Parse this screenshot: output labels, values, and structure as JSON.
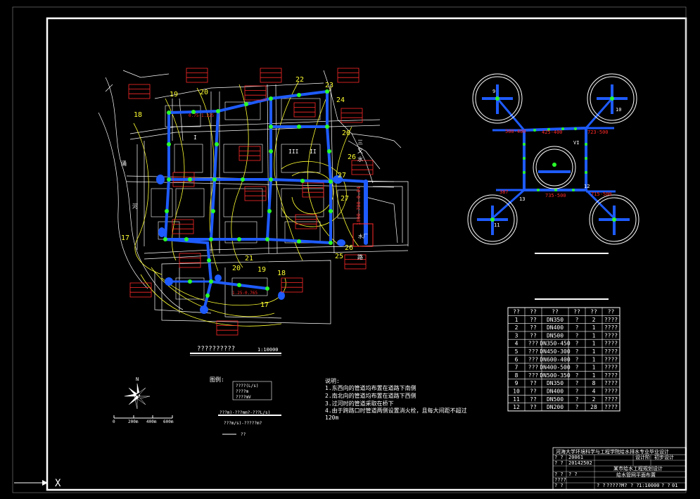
{
  "colors": {
    "pipe": "#1e5bff",
    "node": "#29ff29",
    "contour": "#ffff33",
    "label": "#ff2a2a",
    "frame": "#ffffff"
  },
  "node_numbers": [
    "22",
    "23",
    "24",
    "20",
    "19",
    "18",
    "26",
    "26",
    "27",
    "27",
    "26",
    "25",
    "21",
    "20",
    "19",
    "18",
    "17",
    "17"
  ],
  "zone_labels": [
    "I",
    "II",
    "III",
    "VI"
  ],
  "place_labels": [
    "涌",
    "河",
    "三",
    "又",
    "水",
    "路"
  ],
  "pipe_labels": {
    "main_vertical": "1000-700-0.04",
    "top": "0.75-1.225",
    "bottom": "1.25-0.765",
    "tank": "水厂"
  },
  "detail_labels": {
    "pipe_top": "425-400",
    "pipe_top_right": "723-500",
    "pipe_top_left": "500-400",
    "pipe_bottom": "735-500",
    "pipe_bottom_left": "387",
    "pipe_bottom_right": "715-500",
    "corner_nums": [
      "9",
      "10",
      "11",
      "12",
      "13",
      "14"
    ]
  },
  "scale_title": "??????????",
  "scale_ratio": "1:10000",
  "north": {
    "label": "N",
    "scale_ticks": [
      "0",
      "200m",
      "400m",
      "600m"
    ]
  },
  "legend": {
    "title": "图例:",
    "box_lines": [
      "????(L/s)",
      "????m",
      "????mV"
    ],
    "formula": "???m)-???mm?-???L/s)",
    "formula2": "???m/s)-?????m?",
    "line_label": "??"
  },
  "notes": {
    "title": "说明:",
    "lines": [
      "1.东西向的管道均布置在道路下南侧",
      "2.南北向的管道均布置在道路下西侧",
      "3.过河时的管道采取在桥下",
      "4.由于跨路口时管道两侧设置消火栓，且每大间距不超过",
      "120m"
    ]
  },
  "table": {
    "headers": [
      "??",
      "??",
      "??",
      "??",
      "??",
      "??"
    ],
    "rows": [
      [
        "1",
        "??",
        "DN350",
        "?",
        "2",
        "????"
      ],
      [
        "2",
        "??",
        "DN400",
        "?",
        "1",
        "????"
      ],
      [
        "3",
        "??",
        "DN500",
        "?",
        "1",
        "????"
      ],
      [
        "4",
        "???",
        "DN350-450",
        "?",
        "1",
        "????"
      ],
      [
        "5",
        "???",
        "DN450-300",
        "?",
        "1",
        "????"
      ],
      [
        "6",
        "???",
        "DN600-400",
        "?",
        "1",
        "????"
      ],
      [
        "7",
        "???",
        "DN400-500",
        "?",
        "1",
        "????"
      ],
      [
        "8",
        "???",
        "DN500-350",
        "?",
        "1",
        "????"
      ],
      [
        "9",
        "??",
        "DN350",
        "?",
        "8",
        "????"
      ],
      [
        "10",
        "??",
        "DN400",
        "?",
        "4",
        "????"
      ],
      [
        "11",
        "??",
        "DN500",
        "?",
        "2",
        "????"
      ],
      [
        "12",
        "??",
        "DN200",
        "?",
        "28",
        "????"
      ]
    ]
  },
  "title_block": {
    "school": "河海大学环境科学与工程学院给水排水专业毕业设计",
    "row1": [
      "? ?",
      "20061",
      "设计阶",
      "初步设计"
    ],
    "row2": [
      "? ?",
      "20142502"
    ],
    "project": "某市给水工程规划设计",
    "drawing": "给水管网平面布置",
    "row3": [
      "? ?",
      "? ?"
    ],
    "row4": [
      "????"
    ],
    "row5": [
      "? ?"
    ],
    "footer": [
      "? ?",
      "?????M?",
      "? ?",
      "1:10000",
      "? ?",
      "01"
    ]
  },
  "axis_marker": "X"
}
